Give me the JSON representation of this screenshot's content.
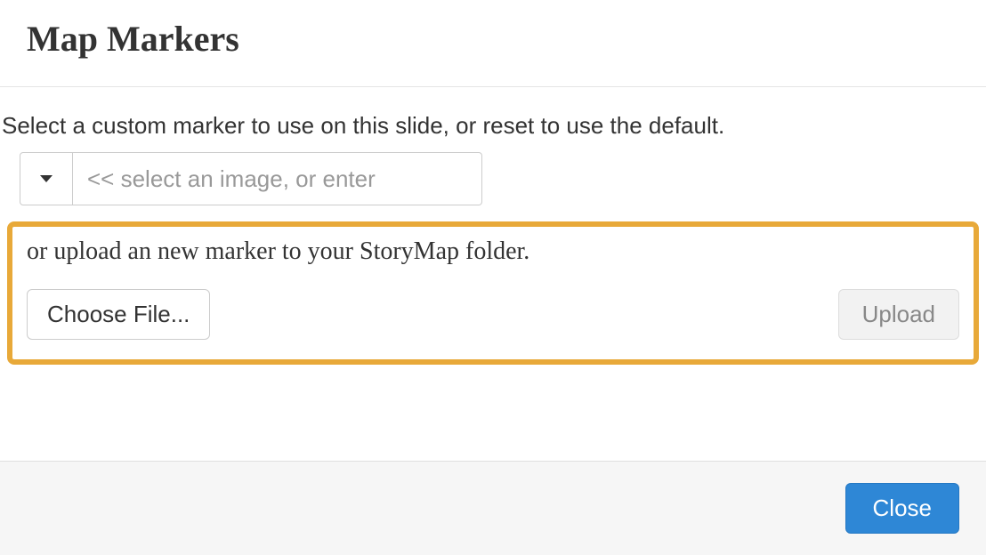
{
  "header": {
    "title": "Map Markers"
  },
  "body": {
    "select_instruction": "Select a custom marker to use on this slide, or reset to use the default.",
    "select_placeholder": "<< select an image, or enter",
    "upload_instruction": "or upload an new marker to your StoryMap folder.",
    "choose_file_label": "Choose File...",
    "upload_label": "Upload"
  },
  "footer": {
    "close_label": "Close"
  }
}
